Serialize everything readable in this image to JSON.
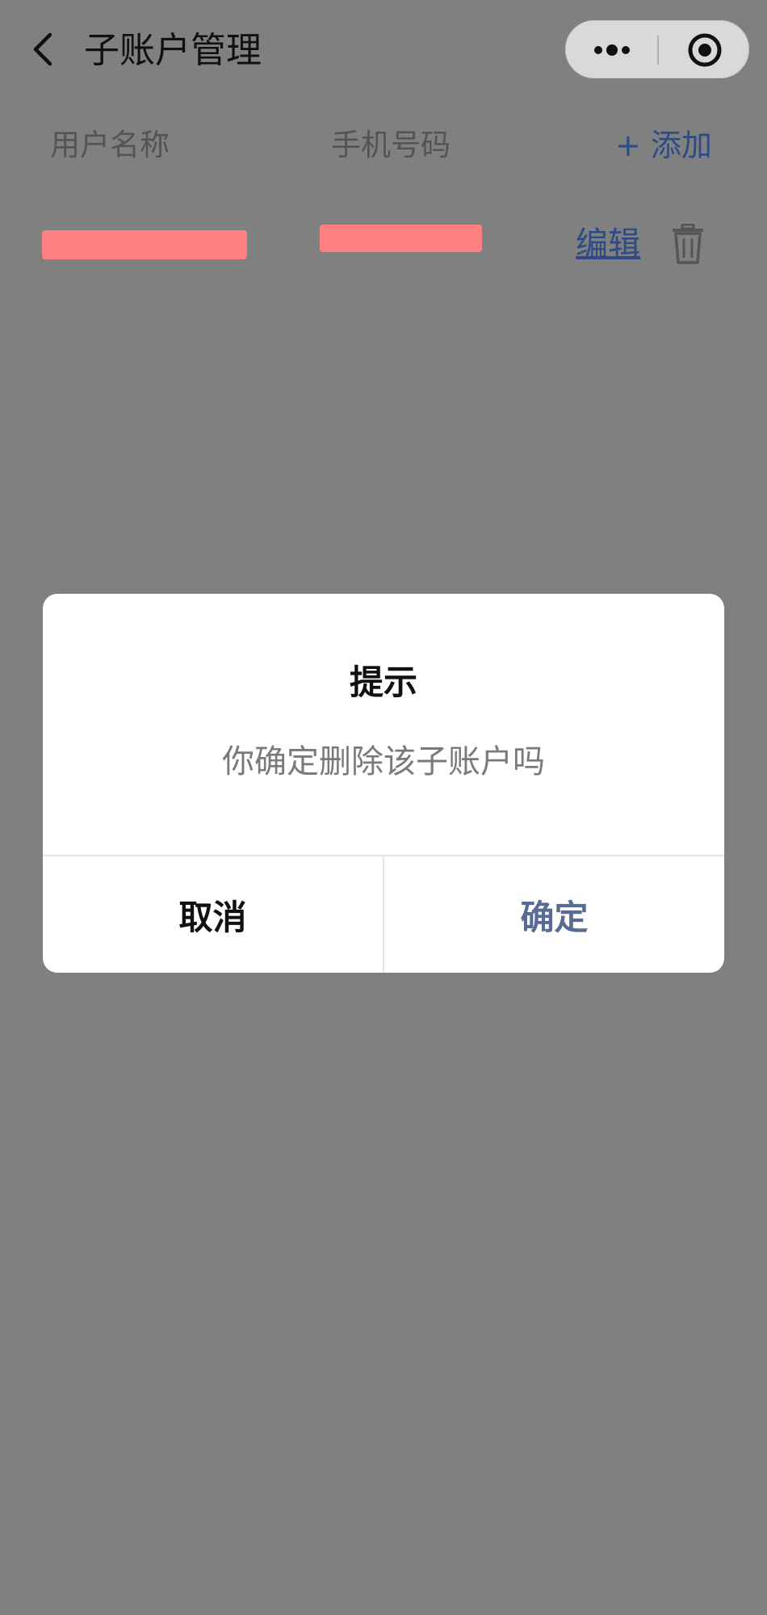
{
  "nav": {
    "title": "子账户管理",
    "back_icon": "chevron-left-icon",
    "more_icon": "more-dots-icon",
    "close_icon": "target-close-icon"
  },
  "table": {
    "headers": {
      "name": "用户名称",
      "phone": "手机号码"
    },
    "add_label": "+ 添加",
    "rows": [
      {
        "edit_label": "编辑",
        "delete_icon": "trash-icon"
      }
    ]
  },
  "dialog": {
    "title": "提示",
    "message": "你确定删除该子账户吗",
    "cancel_label": "取消",
    "confirm_label": "确定"
  },
  "colors": {
    "overlay_background": "#808080",
    "link_blue": "#2d4b86",
    "confirm_blue": "#576b95",
    "redaction": "#ff8080"
  }
}
